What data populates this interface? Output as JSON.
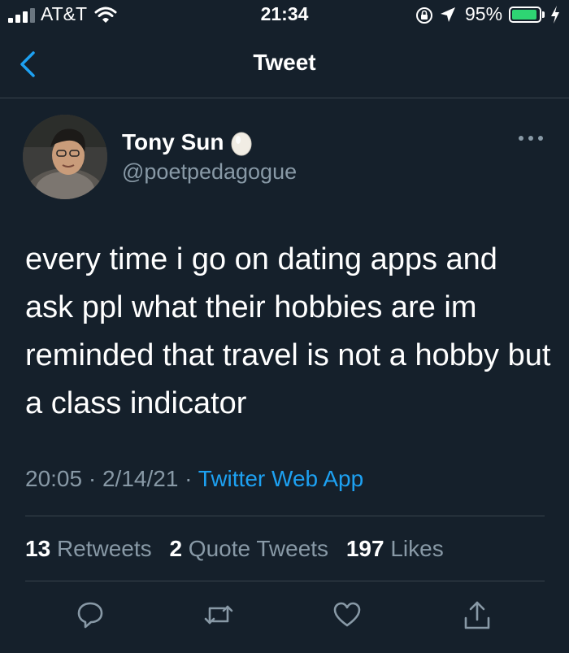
{
  "status_bar": {
    "carrier": "AT&T",
    "time": "21:34",
    "battery_percent": "95%",
    "battery_level": 0.95
  },
  "nav": {
    "title": "Tweet"
  },
  "author": {
    "name": "Tony Sun",
    "handle": "@poetpedagogue"
  },
  "tweet": {
    "text": "every time i go on dating apps and ask ppl what their hobbies are im reminded that travel is not a hobby but a class indicator",
    "time": "20:05",
    "date": "2/14/21",
    "separator": "·",
    "source": "Twitter Web App"
  },
  "stats": {
    "retweets_count": "13",
    "retweets_label": "Retweets",
    "quotes_count": "2",
    "quotes_label": "Quote Tweets",
    "likes_count": "197",
    "likes_label": "Likes"
  },
  "colors": {
    "background": "#15202b",
    "secondary_text": "#8899a6",
    "accent": "#1da1f2",
    "divider": "#38444d",
    "battery": "#2ed573"
  },
  "icons": [
    "signal-icon",
    "wifi-icon",
    "orientation-lock-icon",
    "location-icon",
    "battery-icon",
    "charging-icon",
    "back-chevron-icon",
    "verified-egg-icon",
    "more-icon",
    "reply-icon",
    "retweet-icon",
    "like-icon",
    "share-icon"
  ]
}
